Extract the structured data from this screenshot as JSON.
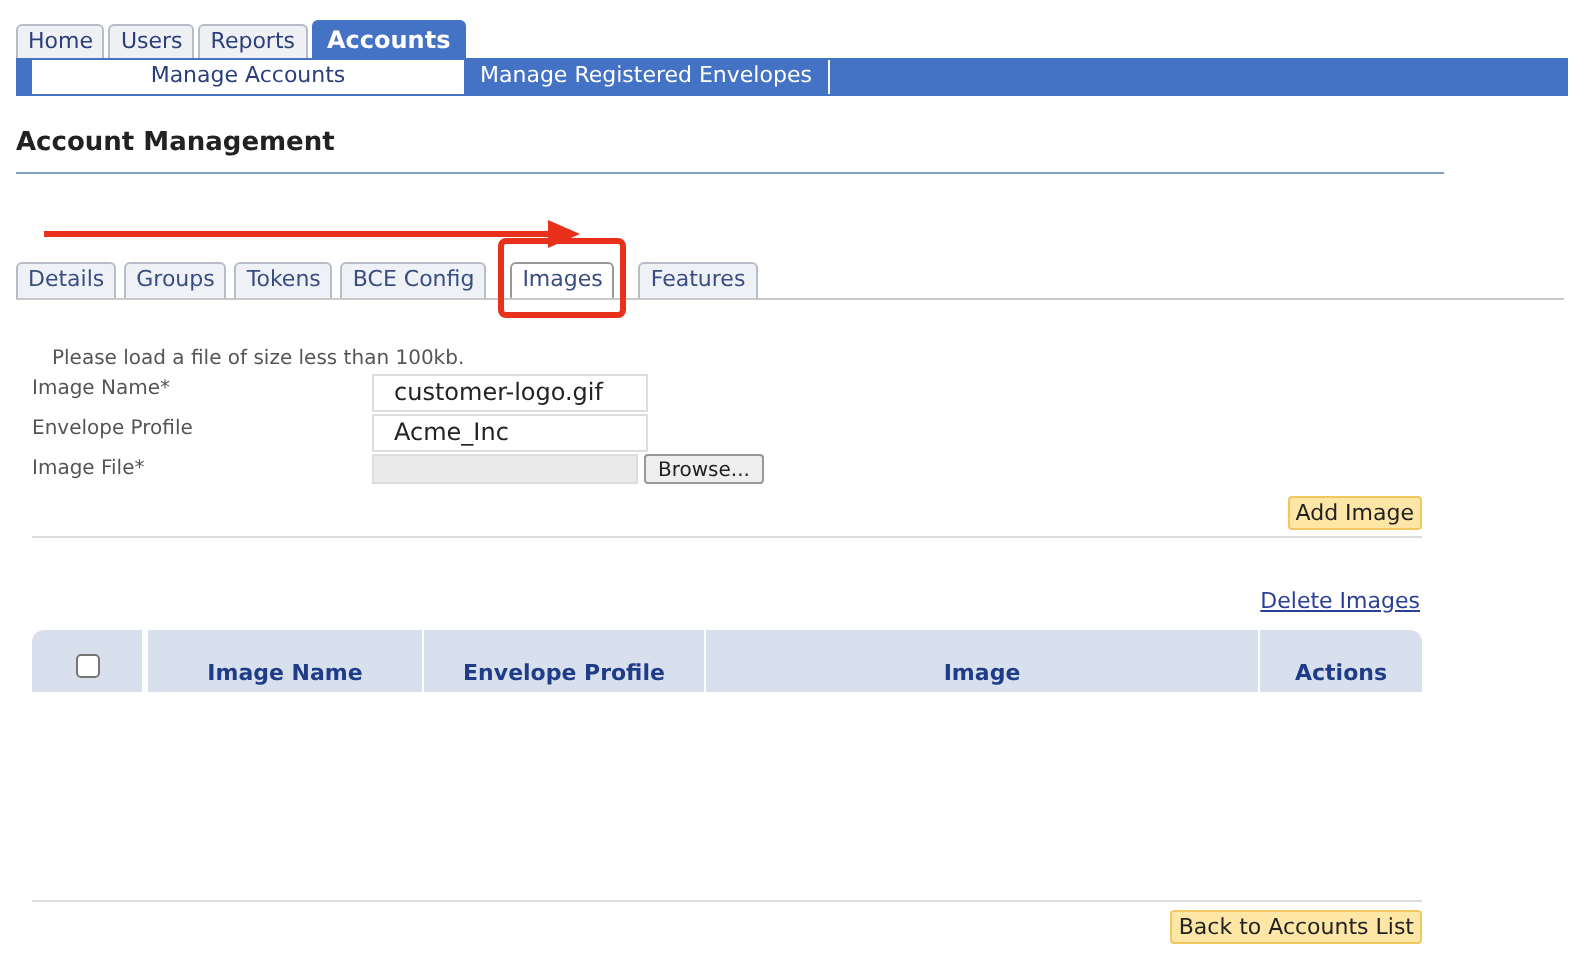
{
  "top_tabs": [
    {
      "label": "Home",
      "selected": false
    },
    {
      "label": "Users",
      "selected": false
    },
    {
      "label": "Reports",
      "selected": false
    },
    {
      "label": "Accounts",
      "selected": true
    }
  ],
  "sub_nav": [
    {
      "label": "Manage Accounts",
      "selected": true
    },
    {
      "label": "Manage Registered Envelopes",
      "selected": false
    }
  ],
  "page_title": "Account Management",
  "tabs": [
    {
      "label": "Details",
      "selected": false,
      "highlighted": false
    },
    {
      "label": "Groups",
      "selected": false,
      "highlighted": false
    },
    {
      "label": "Tokens",
      "selected": false,
      "highlighted": false
    },
    {
      "label": "BCE Config",
      "selected": false,
      "highlighted": false
    },
    {
      "label": "Images",
      "selected": true,
      "highlighted": true
    },
    {
      "label": "Features",
      "selected": false,
      "highlighted": false
    }
  ],
  "form": {
    "note": "Please load a file of size less than 100kb.",
    "fields": [
      {
        "kind": "text",
        "label": "Image Name*",
        "value": "customer-logo.gif"
      },
      {
        "kind": "text",
        "label": "Envelope Profile",
        "value": "Acme_Inc"
      },
      {
        "kind": "file",
        "label": "Image File*",
        "button": "Browse..."
      }
    ],
    "submit": "Add Image"
  },
  "delete_link": "Delete Images",
  "table": {
    "select_all": {
      "checked": false
    },
    "columns": [
      "Image Name",
      "Envelope Profile",
      "Image",
      "Actions"
    ]
  },
  "back_button": "Back to Accounts List"
}
